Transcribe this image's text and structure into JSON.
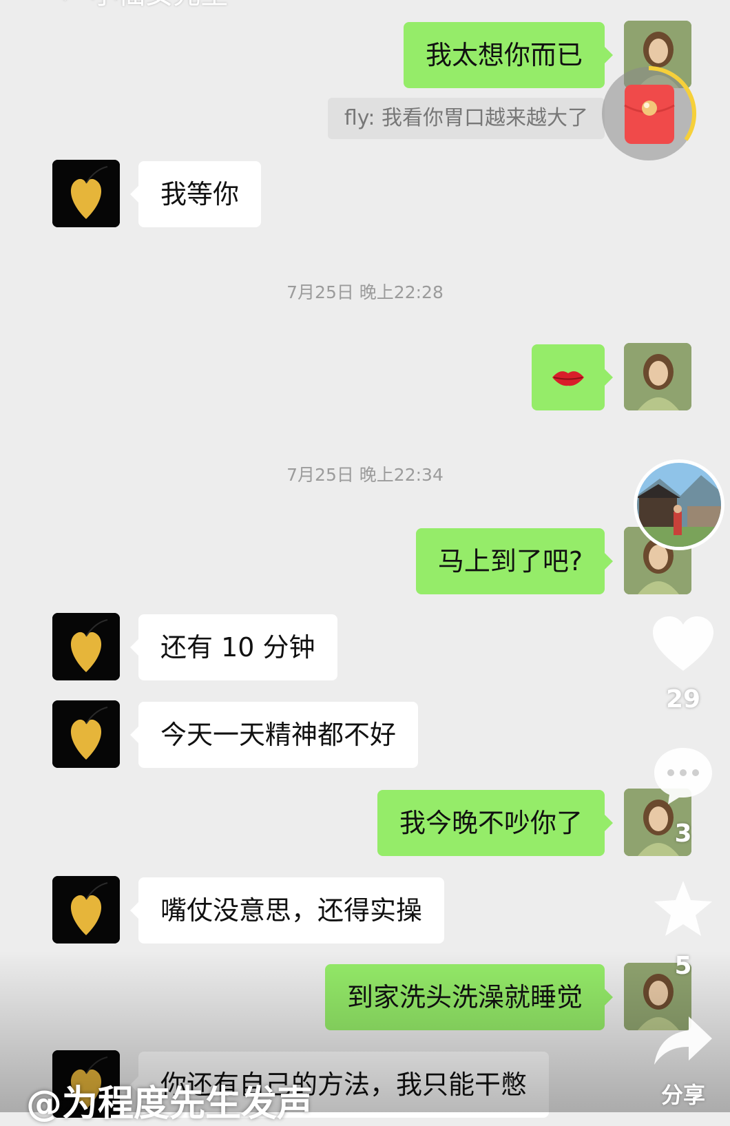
{
  "header": {
    "partial_title": "← 小仙女先生"
  },
  "messages": {
    "m1": "我太想你而已",
    "quote": "fly: 我看你胃口越来越大了",
    "m2": "我等你",
    "time1": "7月25日 晚上22:28",
    "time2": "7月25日 晚上22:34",
    "m4": "马上到了吧?",
    "m5": "还有 10 分钟",
    "m6": "今天一天精神都不好",
    "m7": "我今晚不吵你了",
    "m8": "嘴仗没意思，还得实操",
    "m9": "到家洗头洗澡就睡觉",
    "m10": "你还有自己的方法，我只能干憋"
  },
  "sidebar": {
    "like_count": "29",
    "comment_count": "3",
    "favorite_count": "5",
    "share_label": "分享"
  },
  "watermark": "@为程度先生发声",
  "icons": [
    "red-packet-icon",
    "lips-emoji-icon",
    "heart-icon",
    "comment-icon",
    "star-icon",
    "share-icon"
  ],
  "colors": {
    "outgoing_bubble": "#95ec69",
    "incoming_bubble": "#ffffff",
    "background": "#ededed",
    "red_packet": "#f04a4a"
  }
}
